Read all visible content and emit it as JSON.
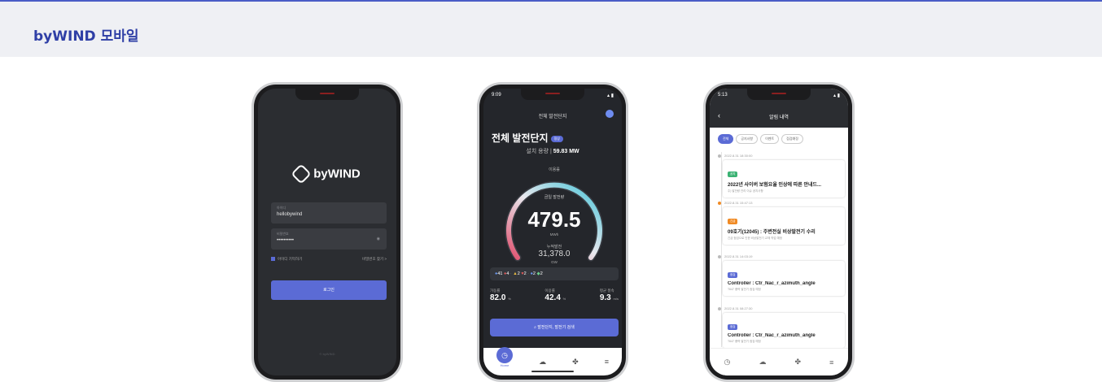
{
  "section": {
    "title": "byWIND 모바일"
  },
  "login": {
    "status_time": "",
    "logo_text": "byWIND",
    "id_label": "아이디",
    "id_value": "hellobywind",
    "pw_label": "비밀번호",
    "pw_value": "••••••••••",
    "remember_label": "아이디 기억하기",
    "find_pw": "비밀번호 찾기 >",
    "login_button": "로그인",
    "copyright": "© byWIND"
  },
  "dashboard": {
    "status_time": "9:09",
    "header_title": "전체 발전단지",
    "heading": "전체 발전단지",
    "heading_badge": "정상",
    "capacity_label": "설치 용량",
    "capacity_value": "59.83 MW",
    "gauge_top_label": "이용률",
    "current_power_label": "금일 발전량",
    "current_power_value": "479.5",
    "current_power_unit": "MWh",
    "cumulative_label": "누적발전",
    "cumulative_value": "31,378.0",
    "cumulative_unit": "GW",
    "status_counts": {
      "run": "41",
      "stop": "4",
      "warn": "2",
      "fault": "2",
      "comm_a": "2",
      "comm_b": "2"
    },
    "stats": [
      {
        "label": "가동률",
        "value": "82.0",
        "unit": "%"
      },
      {
        "label": "이용률",
        "value": "42.4",
        "unit": "%"
      },
      {
        "label": "평균 풍속",
        "value": "9.3",
        "unit": "m/s"
      }
    ],
    "search_button": "발전단지, 발전기 검색",
    "nav": [
      {
        "label": "Home"
      },
      {
        "label": ""
      },
      {
        "label": ""
      },
      {
        "label": ""
      }
    ]
  },
  "notifications": {
    "status_time": "5:13",
    "header_title": "알림 내역",
    "filters": [
      "전체",
      "공지사항",
      "이벤트",
      "점검예정"
    ],
    "items": [
      {
        "date": "2022.8.31 18:30:00",
        "tag": "공지",
        "tag_color": "#3bb273",
        "title": "2022년 사이버 보험요율 인상에 따른 안내드...",
        "sub": "주) 발전량 관리 이슈 공지사항"
      },
      {
        "date": "2022.8.31 15:47:13",
        "tag": "긴급",
        "tag_color": "#f08a24",
        "title": "09호기(12045) : 주변전실 비상발전기 수리",
        "sub": "긴급 점검으로 인한 비상발전기 교체 작업 예정"
      },
      {
        "date": "2022.8.31 14:03:19",
        "tag": "점검",
        "tag_color": "#5b6bd5",
        "title": "Controller : Ctr_Nac_r_azimuth_angle",
        "sub": "T647 풍력 발전기 점검 예정"
      },
      {
        "date": "2022.8.31 08:27:30",
        "tag": "점검",
        "tag_color": "#5b6bd5",
        "title": "Controller : Ctr_Nac_r_azimuth_angle",
        "sub": "T647 풍력 발전기 점검 예정"
      }
    ]
  },
  "colors": {
    "accent": "#5b6bd5",
    "header_bg": "#eff0f4",
    "title": "#2f3fa6"
  }
}
